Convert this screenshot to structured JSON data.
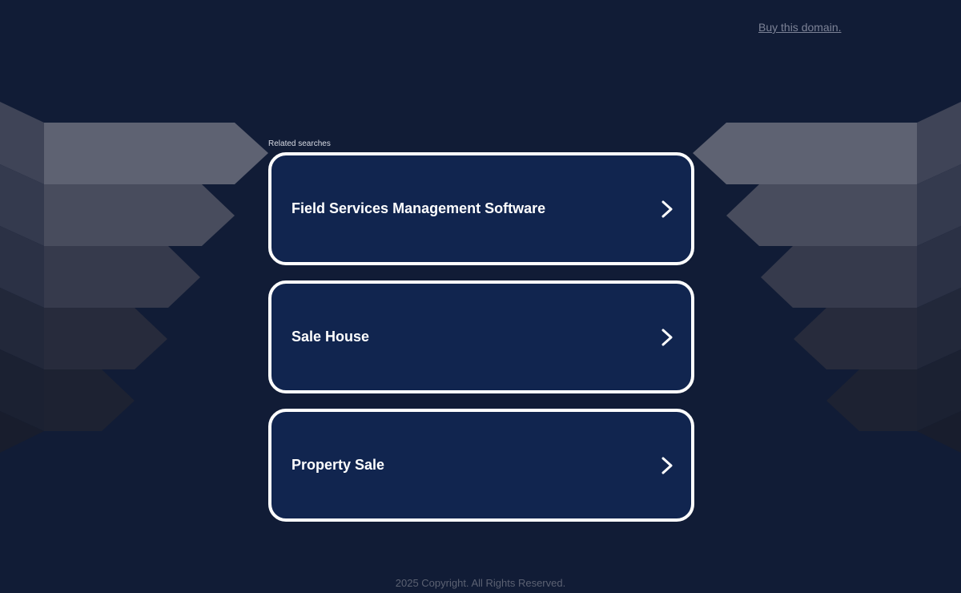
{
  "header": {
    "buy_link": "Buy this domain."
  },
  "related": {
    "label": "Related searches",
    "items": [
      {
        "label": "Field Services Management Software",
        "icon": "chevron-right-icon"
      },
      {
        "label": "Sale House",
        "icon": "chevron-right-icon"
      },
      {
        "label": "Property Sale",
        "icon": "chevron-right-icon"
      }
    ]
  },
  "footer": {
    "copyright": "2025 Copyright. All Rights Reserved."
  },
  "colors": {
    "background": "#111c36",
    "card_background": "#11254f",
    "card_border": "#ffffff",
    "link": "#7c8296"
  }
}
